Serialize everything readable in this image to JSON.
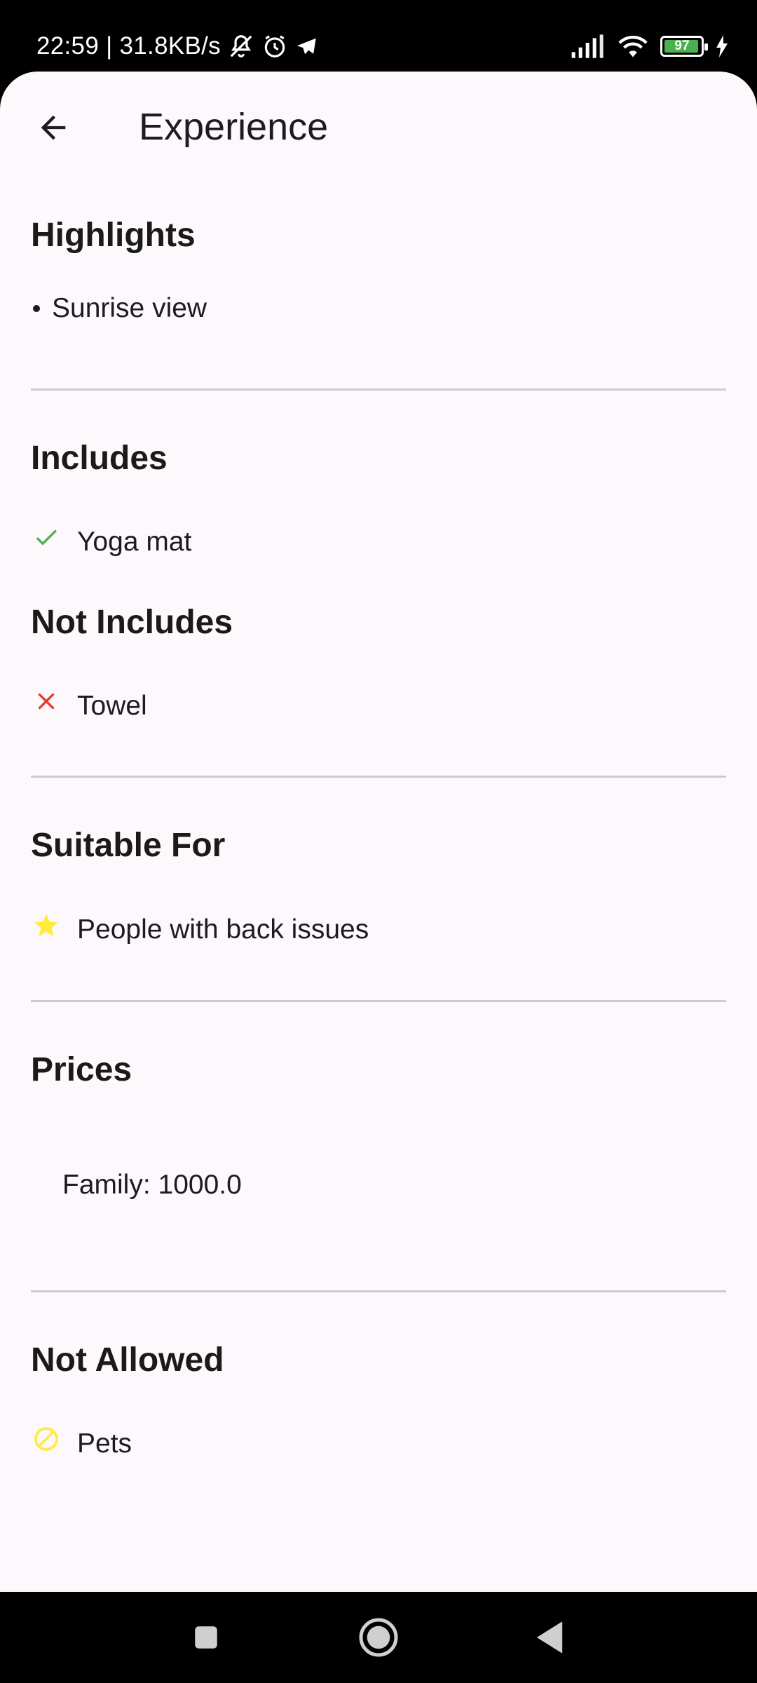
{
  "status_bar": {
    "time_speed": "22:59 | 31.8KB/s",
    "battery_level": "97",
    "icons": [
      "mute-vibrate-icon",
      "alarm-icon",
      "telegram-icon",
      "signal-icon",
      "wifi-icon",
      "battery-icon",
      "charging-icon"
    ]
  },
  "app_bar": {
    "title": "Experience",
    "back_icon": "arrow-left-icon"
  },
  "sections": {
    "highlights": {
      "title": "Highlights",
      "items": [
        "Sunrise view"
      ]
    },
    "includes": {
      "title": "Includes",
      "items": [
        "Yoga mat"
      ],
      "icon": "check-icon",
      "icon_color": "#4caf50"
    },
    "not_includes": {
      "title": "Not Includes",
      "items": [
        "Towel"
      ],
      "icon": "close-icon",
      "icon_color": "#e53935"
    },
    "suitable_for": {
      "title": "Suitable For",
      "items": [
        "People with back issues"
      ],
      "icon": "star-icon",
      "icon_color": "#ffeb3b"
    },
    "prices": {
      "title": "Prices",
      "items": [
        "Family: 1000.0"
      ]
    },
    "not_allowed": {
      "title": "Not Allowed",
      "items": [
        "Pets"
      ],
      "icon": "block-icon",
      "icon_color": "#ffeb3b"
    }
  },
  "nav_bar": {
    "buttons": [
      "recent-apps-icon",
      "home-icon",
      "back-triangle-icon"
    ]
  }
}
